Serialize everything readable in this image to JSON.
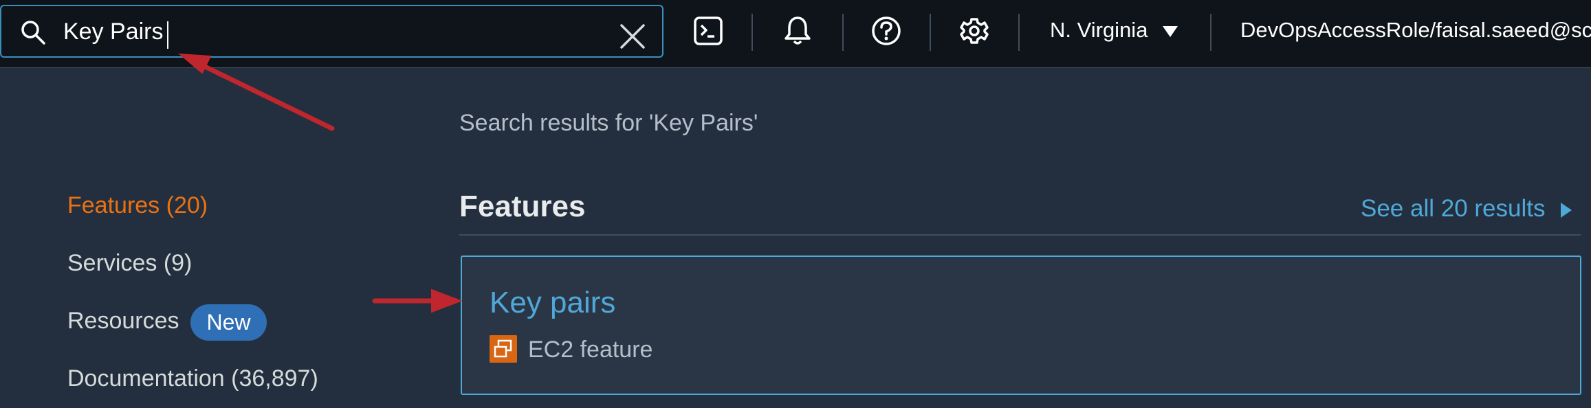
{
  "search": {
    "value": "Key Pairs",
    "placeholder": "Search"
  },
  "topbar": {
    "icons": [
      "cloudshell-icon",
      "bell-icon",
      "help-icon",
      "gear-icon"
    ],
    "region": "N. Virginia",
    "account": "DevOpsAccessRole/faisal.saeed@sc"
  },
  "sidebar": {
    "items": [
      {
        "label": "Features (20)",
        "active": true
      },
      {
        "label": "Services (9)",
        "active": false
      },
      {
        "label": "Resources",
        "active": false,
        "badge": "New"
      },
      {
        "label": "Documentation (36,897)",
        "active": false
      }
    ]
  },
  "results": {
    "heading": "Search results for 'Key Pairs'",
    "section_title": "Features",
    "see_all": "See all 20 results",
    "items": [
      {
        "title": "Key pairs",
        "subtitle": "EC2 feature",
        "icon": "ec2-icon"
      }
    ]
  },
  "colors": {
    "background": "#232f3e",
    "topbar": "#0f141a",
    "accent_orange": "#ec7211",
    "link_blue": "#4fa8d8",
    "badge_blue": "#2f6fb5",
    "annotation_red": "#c0262d"
  }
}
